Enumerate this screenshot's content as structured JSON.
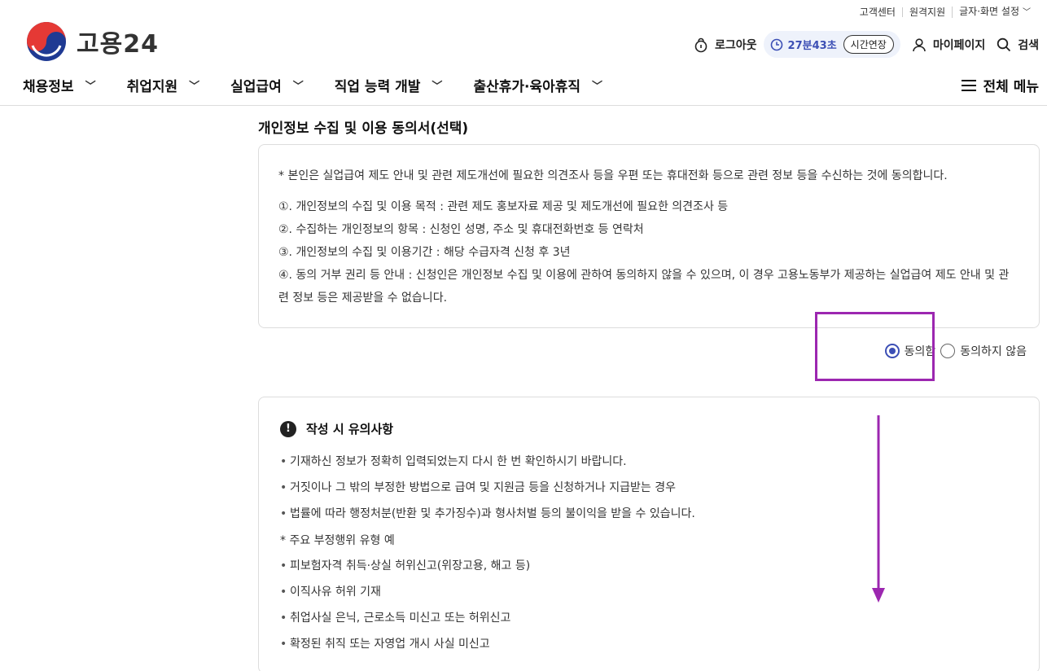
{
  "utility": {
    "items": [
      "고객센터",
      "원격지원",
      "글자·화면 설정"
    ]
  },
  "logo": {
    "text": "고용24"
  },
  "actions": {
    "logout": "로그아웃",
    "timer": "27분43초",
    "extend": "시간연장",
    "mypage": "마이페이지",
    "search": "검색"
  },
  "gnb": {
    "items": [
      "채용정보",
      "취업지원",
      "실업급여",
      "직업 능력 개발",
      "출산휴가·육아휴직"
    ],
    "full_menu": "전체 메뉴"
  },
  "consent": {
    "title": "개인정보 수집 및 이용 동의서(선택)",
    "intro": "* 본인은 실업급여 제도 안내 및 관련 제도개선에 필요한 의견조사 등을 우편 또는 휴대전화 등으로 관련 정보 등을 수신하는 것에 동의합니다.",
    "lines": [
      "①. 개인정보의 수집 및 이용 목적 : 관련 제도 홍보자료 제공 및 제도개선에 필요한 의견조사 등",
      "②. 수집하는 개인정보의 항목 : 신청인 성명, 주소 및 휴대전화번호 등 연락처",
      "③. 개인정보의 수집 및 이용기간 : 해당 수급자격 신청 후 3년",
      "④. 동의 거부 권리 등 안내 : 신청인은 개인정보 수집 및 이용에 관하여 동의하지 않을 수 있으며, 이 경우 고용노동부가 제공하는 실업급여 제도 안내 및 관련 정보 등은 제공받을 수 없습니다."
    ],
    "agree": "동의함",
    "disagree": "동의하지 않음",
    "selected": "agree"
  },
  "notice": {
    "title": "작성 시 유의사항",
    "bullets": [
      "기재하신 정보가 정확히 입력되었는지 다시 한 번 확인하시기 바랍니다.",
      "거짓이나 그 밖의 부정한 방법으로 급여 및 지원금 등을 신청하거나 지급받는 경우",
      "법률에 따라 행정처분(반환 및 추가징수)과 형사처벌 등의 불이익을 받을 수 있습니다."
    ],
    "sub_title": "* 주요 부정행위 유형 예",
    "sub_bullets": [
      "피보험자격 취득·상실 허위신고(위장고용, 해고 등)",
      "이직사유 허위 기재",
      "취업사실 은닉, 근로소득 미신고 또는 허위신고",
      "확정된 취직 또는 자영업 개시 사실 미신고"
    ]
  },
  "colors": {
    "accent": "#3c4fb5",
    "highlight": "#9c27b0",
    "border": "#dddddd"
  }
}
